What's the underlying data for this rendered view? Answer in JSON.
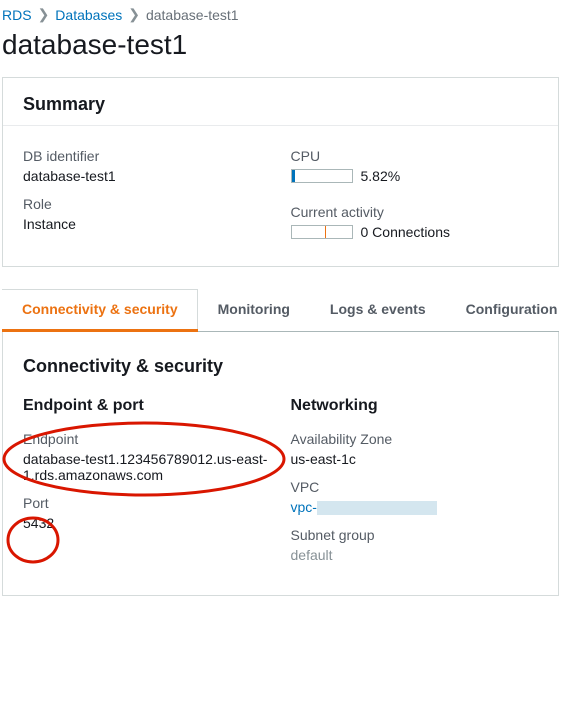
{
  "breadcrumb": {
    "root": "RDS",
    "parent": "Databases",
    "current": "database-test1"
  },
  "pageTitle": "database-test1",
  "summary": {
    "title": "Summary",
    "left": {
      "idLabel": "DB identifier",
      "idValue": "database-test1",
      "roleLabel": "Role",
      "roleValue": "Instance"
    },
    "right": {
      "cpuLabel": "CPU",
      "cpuPercent": "5.82%",
      "cpuFill": 6,
      "activityLabel": "Current activity",
      "activityValue": "0 Connections",
      "activityTick": 55
    }
  },
  "tabs": [
    "Connectivity & security",
    "Monitoring",
    "Logs & events",
    "Configuration"
  ],
  "tabActive": 0,
  "cs": {
    "title": "Connectivity & security",
    "left": {
      "heading": "Endpoint & port",
      "endpointLabel": "Endpoint",
      "endpointValue": "database-test1.123456789012.us-east-1.rds.amazonaws.com",
      "portLabel": "Port",
      "portValue": "5432"
    },
    "right": {
      "heading": "Networking",
      "azLabel": "Availability Zone",
      "azValue": "us-east-1c",
      "vpcLabel": "VPC",
      "vpcValue": "vpc-",
      "subnetLabel": "Subnet group",
      "subnetValue": "default"
    }
  }
}
